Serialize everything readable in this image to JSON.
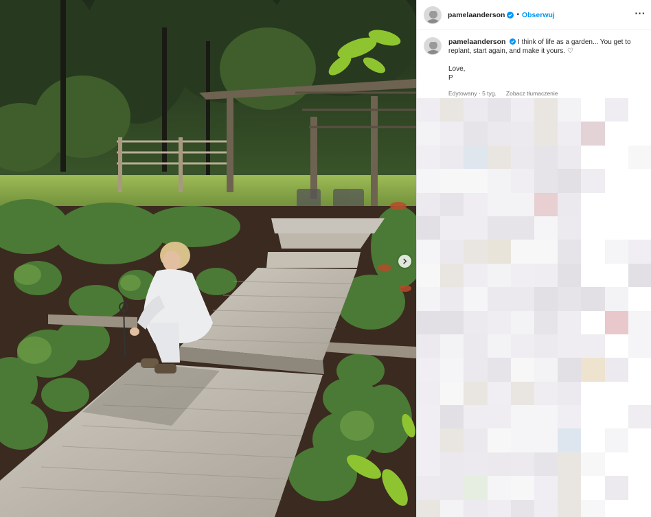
{
  "post": {
    "username": "pamelaanderson",
    "follow_label": "Obserwuj",
    "more_icon": "more-horizontal-icon",
    "verified_icon": "verified-badge-icon",
    "caption": {
      "username": "pamelaanderson",
      "text": "I think of life as a garden... You get to replant, start again, and make it yours. ♡\n\nLove,\nP",
      "edited": "Edytowany · 5 tyg.",
      "translate": "Zobacz tłumaczenie"
    },
    "carousel_next_icon": "chevron-right-icon"
  },
  "colors": {
    "accent": "#0095f6",
    "verified": "#0095f6",
    "muted": "#737373"
  }
}
